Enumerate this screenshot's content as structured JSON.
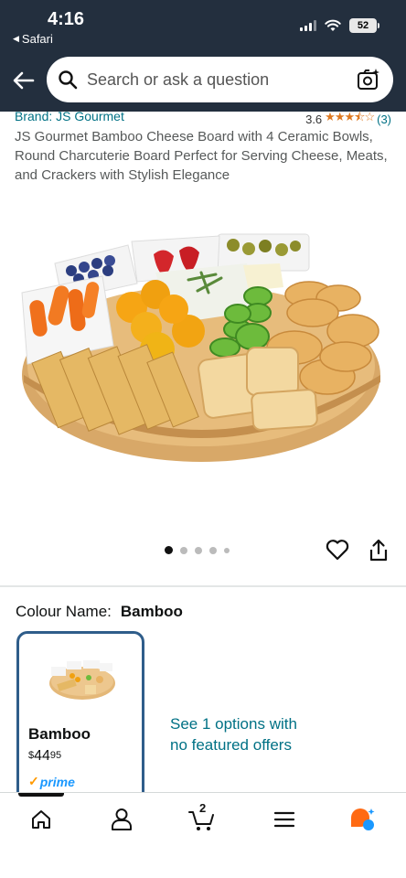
{
  "status_bar": {
    "time": "4:16",
    "back_app": "Safari",
    "battery": "52"
  },
  "search": {
    "placeholder": "Search or ask a question"
  },
  "product": {
    "brand": "Brand: JS Gourmet",
    "rating": "3.6",
    "stars_filled": 3.5,
    "stars_text": "★★★⯪☆",
    "rating_count": "(3)",
    "title": "JS Gourmet Bamboo Cheese Board with 4 Ceramic Bowls, Round Charcuterie Board Perfect for Serving Cheese, Meats, and Crackers with Stylish Elegance",
    "image_count": 5,
    "active_image": 1
  },
  "variation": {
    "label": "Colour Name:",
    "value": "Bamboo",
    "card": {
      "name": "Bamboo",
      "price_symbol": "$",
      "price_whole": "44",
      "price_fraction": "95",
      "prime_check": "✓",
      "prime_label": "prime"
    },
    "options_link": "See 1 options with no featured offers"
  },
  "bottom_nav": {
    "items": [
      "home",
      "account",
      "cart",
      "menu",
      "rufus"
    ],
    "cart_count": "2"
  },
  "colors": {
    "header_bg": "#232F3E",
    "link": "#007185",
    "star": "#DE7921",
    "prime": "#1A98FF",
    "selected_border": "#2F5D8A"
  }
}
